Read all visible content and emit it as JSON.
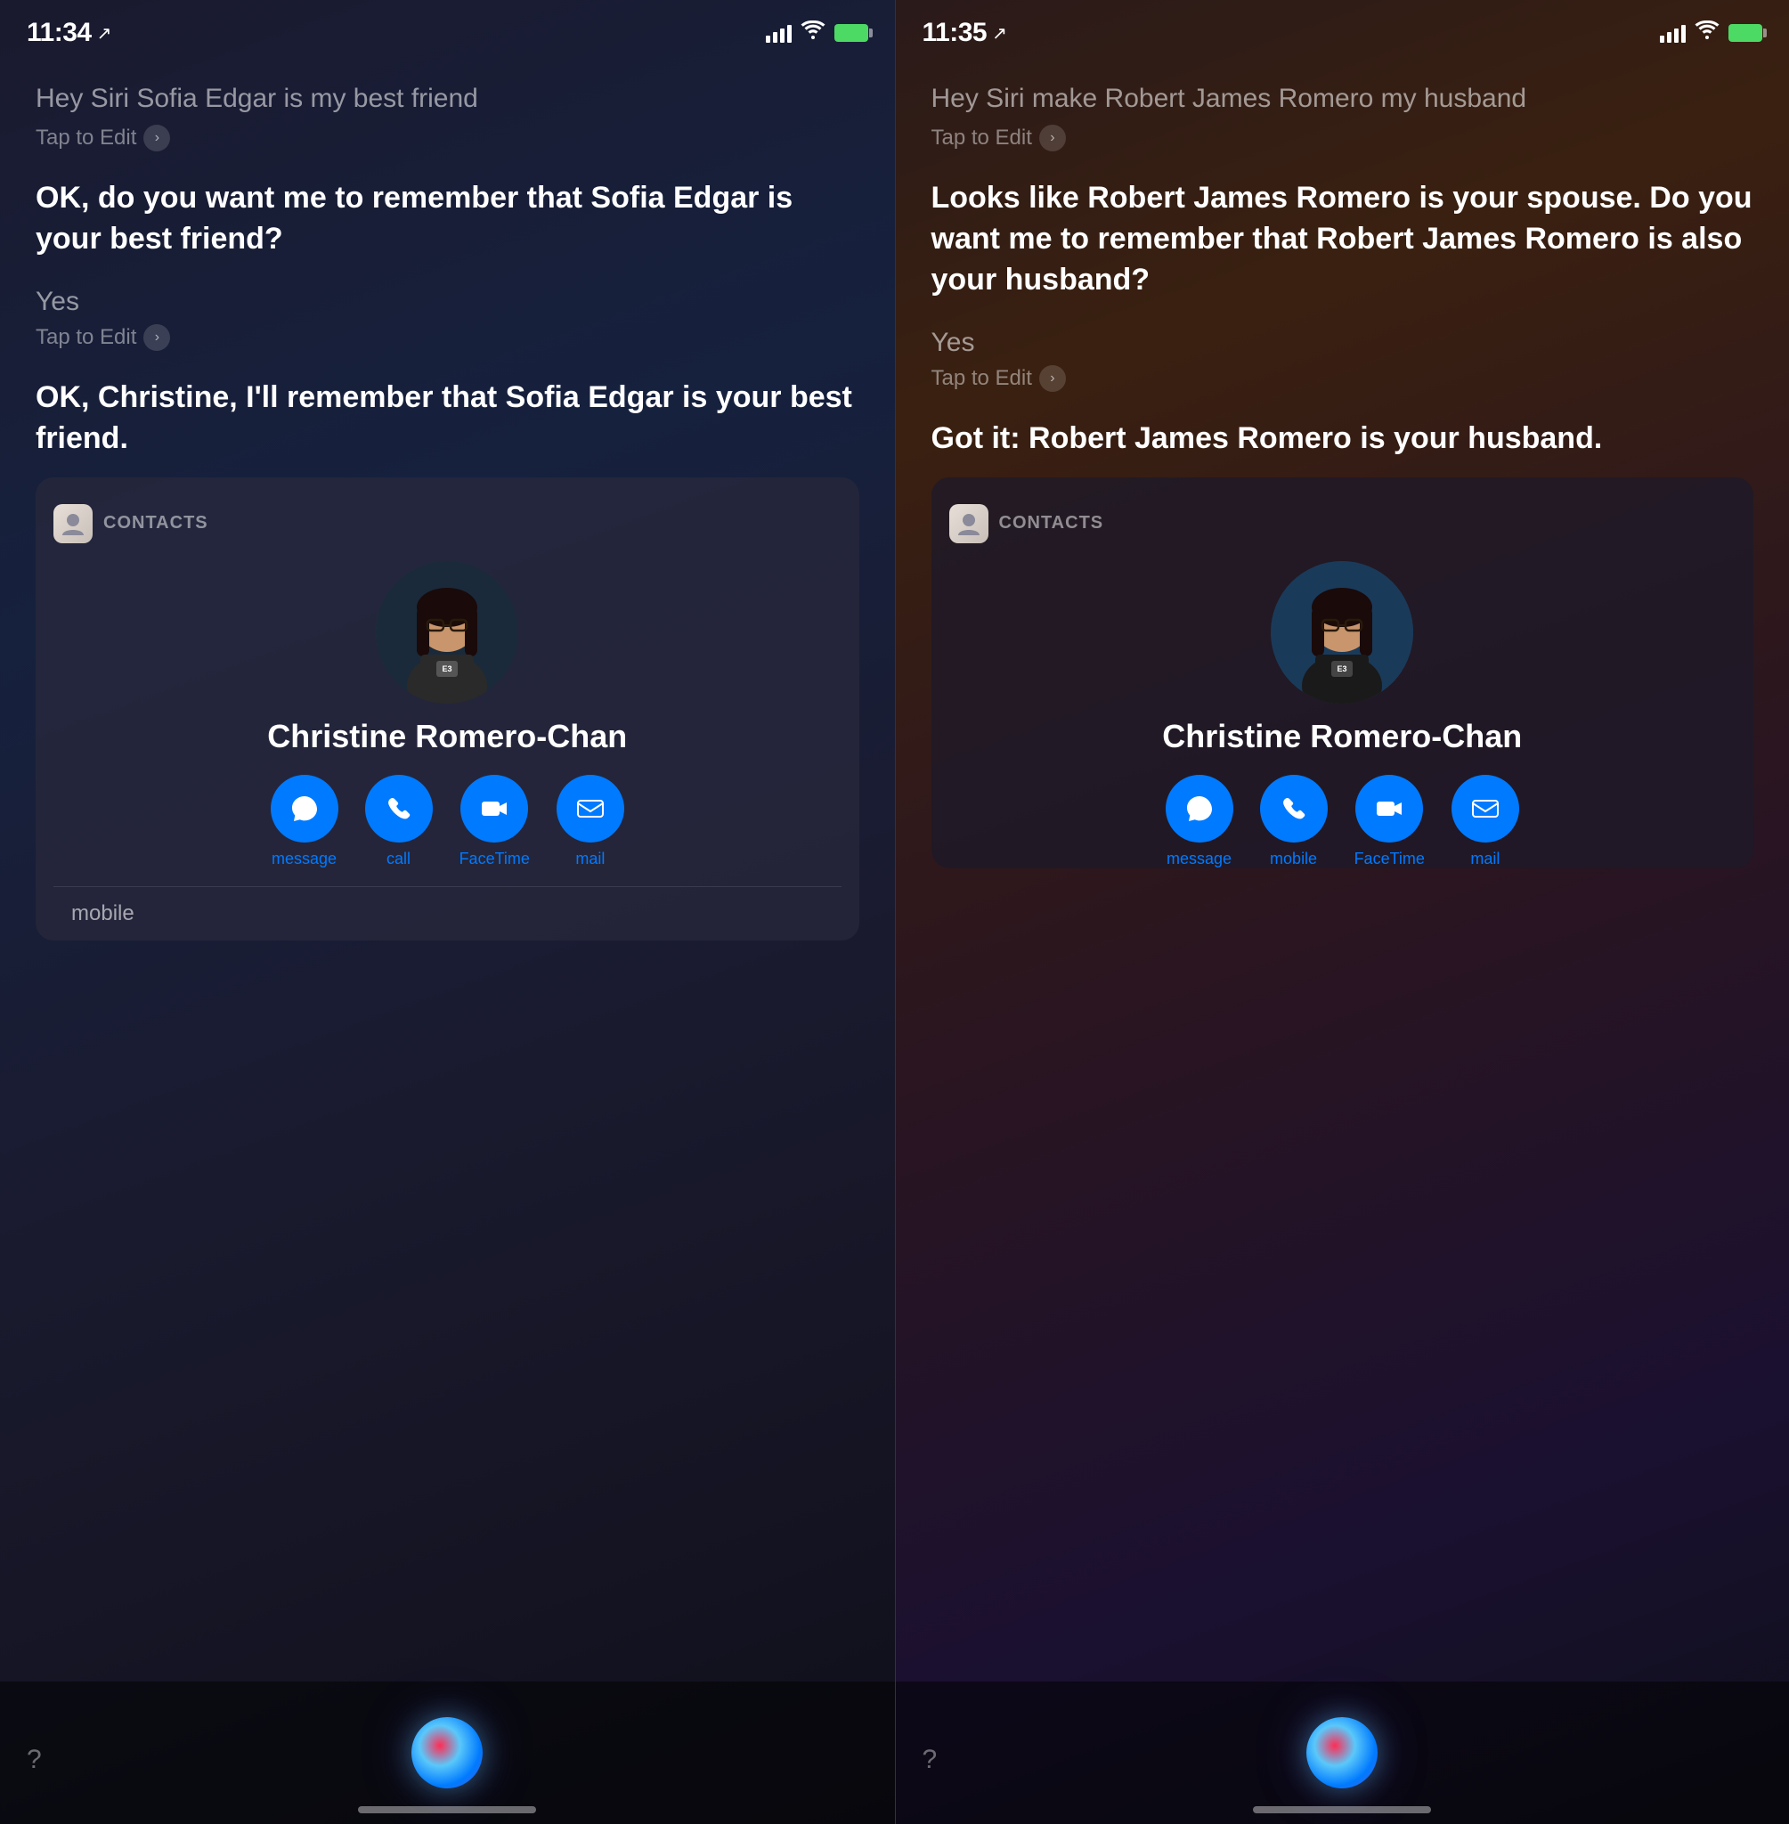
{
  "left": {
    "statusBar": {
      "time": "11:34",
      "locationIcon": "↗"
    },
    "conversation": [
      {
        "type": "query",
        "text": "Hey Siri Sofia Edgar is my best friend",
        "tapToEdit": "Tap to Edit"
      },
      {
        "type": "siri",
        "text": "OK, do you want me to remember that Sofia Edgar is your best friend?"
      },
      {
        "type": "reply",
        "text": "Yes",
        "tapToEdit": "Tap to Edit"
      },
      {
        "type": "siri",
        "text": "OK, Christine, I'll remember that Sofia Edgar is your best friend."
      }
    ],
    "contacts": {
      "appLabel": "CONTACTS",
      "contactName": "Christine Romero-Chan",
      "actions": [
        {
          "label": "message",
          "icon": "💬"
        },
        {
          "label": "call",
          "icon": "📞"
        },
        {
          "label": "FaceTime",
          "icon": "📷"
        },
        {
          "label": "mail",
          "icon": "✉️"
        }
      ],
      "mobileLabel": "mobile"
    },
    "bottomBar": {
      "questionMark": "?",
      "siriLabel": "siri-orb"
    }
  },
  "right": {
    "statusBar": {
      "time": "11:35",
      "locationIcon": "↗"
    },
    "conversation": [
      {
        "type": "query",
        "text": "Hey Siri make Robert James Romero my husband",
        "tapToEdit": "Tap to Edit"
      },
      {
        "type": "siri",
        "text": "Looks like Robert James Romero is your spouse. Do you want me to remember that Robert James Romero is also your husband?"
      },
      {
        "type": "reply",
        "text": "Yes",
        "tapToEdit": "Tap to Edit"
      },
      {
        "type": "siri",
        "text": "Got it: Robert James Romero is your husband."
      }
    ],
    "contacts": {
      "appLabel": "CONTACTS",
      "contactName": "Christine Romero-Chan",
      "actions": [
        {
          "label": "message",
          "icon": "💬"
        },
        {
          "label": "mobile",
          "icon": "📞"
        },
        {
          "label": "FaceTime",
          "icon": "📷"
        },
        {
          "label": "mail",
          "icon": "✉️"
        }
      ]
    },
    "bottomBar": {
      "questionMark": "?",
      "siriLabel": "siri-orb"
    }
  }
}
